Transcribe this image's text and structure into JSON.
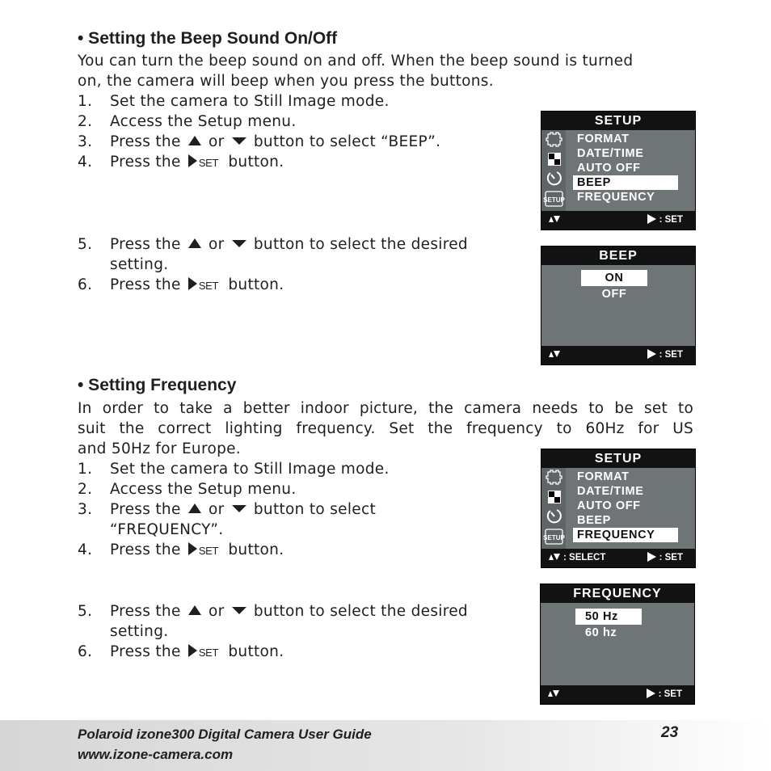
{
  "beep_section": {
    "heading": "• Setting the Beep Sound On/Off",
    "intro_line1": "You can turn the beep sound on and off. When the beep sound is turned",
    "intro_line2": "on, the camera will beep when you press the buttons.",
    "steps": [
      {
        "num": "1.",
        "text": "Set the camera to Still Image mode."
      },
      {
        "num": "2.",
        "text": "Access the Setup menu."
      },
      {
        "num": "3.",
        "pre": "Press the",
        "mid": "or",
        "post": "button to select “BEEP”."
      },
      {
        "num": "4.",
        "pre": "Press the",
        "set": "SET",
        "post": "button."
      },
      {
        "num": "5.",
        "pre": "Press the",
        "mid": "or",
        "post": "button to select the desired",
        "cont": "setting."
      },
      {
        "num": "6.",
        "pre": "Press the",
        "set": "SET",
        "post": "button."
      }
    ]
  },
  "frequency_section": {
    "heading": "• Setting Frequency",
    "intro_line1": "In order to take a better indoor picture, the camera needs to be set to",
    "intro_line2": "suit the correct lighting frequency. Set the frequency to 60Hz for US",
    "intro_line3": "and 50Hz for Europe.",
    "steps": [
      {
        "num": "1.",
        "text": "Set the camera to Still Image mode."
      },
      {
        "num": "2.",
        "text": "Access the Setup menu."
      },
      {
        "num": "3.",
        "pre": "Press the",
        "mid": "or",
        "post": "button to select",
        "cont": "“FREQUENCY”."
      },
      {
        "num": "4.",
        "pre": "Press the",
        "set": "SET",
        "post": "button."
      },
      {
        "num": "5.",
        "pre": "Press the",
        "mid": "or",
        "post": "button to select the desired",
        "cont": "setting."
      },
      {
        "num": "6.",
        "pre": "Press the",
        "set": "SET",
        "post": "button."
      }
    ]
  },
  "screens": {
    "setup_beep": {
      "title": "SETUP",
      "items": [
        "FORMAT",
        "DATE/TIME",
        "AUTO OFF",
        "BEEP",
        "FREQUENCY"
      ],
      "selected": "BEEP",
      "bottom_left": "",
      "bottom_right": ":  SET"
    },
    "beep_menu": {
      "title": "BEEP",
      "options": [
        "ON",
        "OFF"
      ],
      "selected": "ON",
      "bottom_right": ":  SET"
    },
    "setup_frequency": {
      "title": "SETUP",
      "items": [
        "FORMAT",
        "DATE/TIME",
        "AUTO OFF",
        "BEEP",
        "FREQUENCY"
      ],
      "selected": "FREQUENCY",
      "bottom_left": ":  SELECT",
      "bottom_right": ":  SET"
    },
    "frequency_menu": {
      "title": "FREQUENCY",
      "options": [
        "50 Hz",
        "60 hz"
      ],
      "selected": "50 Hz",
      "bottom_right": ":  SET"
    },
    "side_icons": [
      "format-icon",
      "date-time-icon",
      "auto-off-icon",
      "setup-icon"
    ],
    "setup_icon_label": "SETUP"
  },
  "footer": {
    "guide_title": "Polaroid izone300 Digital Camera User Guide",
    "website": "www.izone-camera.com",
    "page_number": "23"
  }
}
